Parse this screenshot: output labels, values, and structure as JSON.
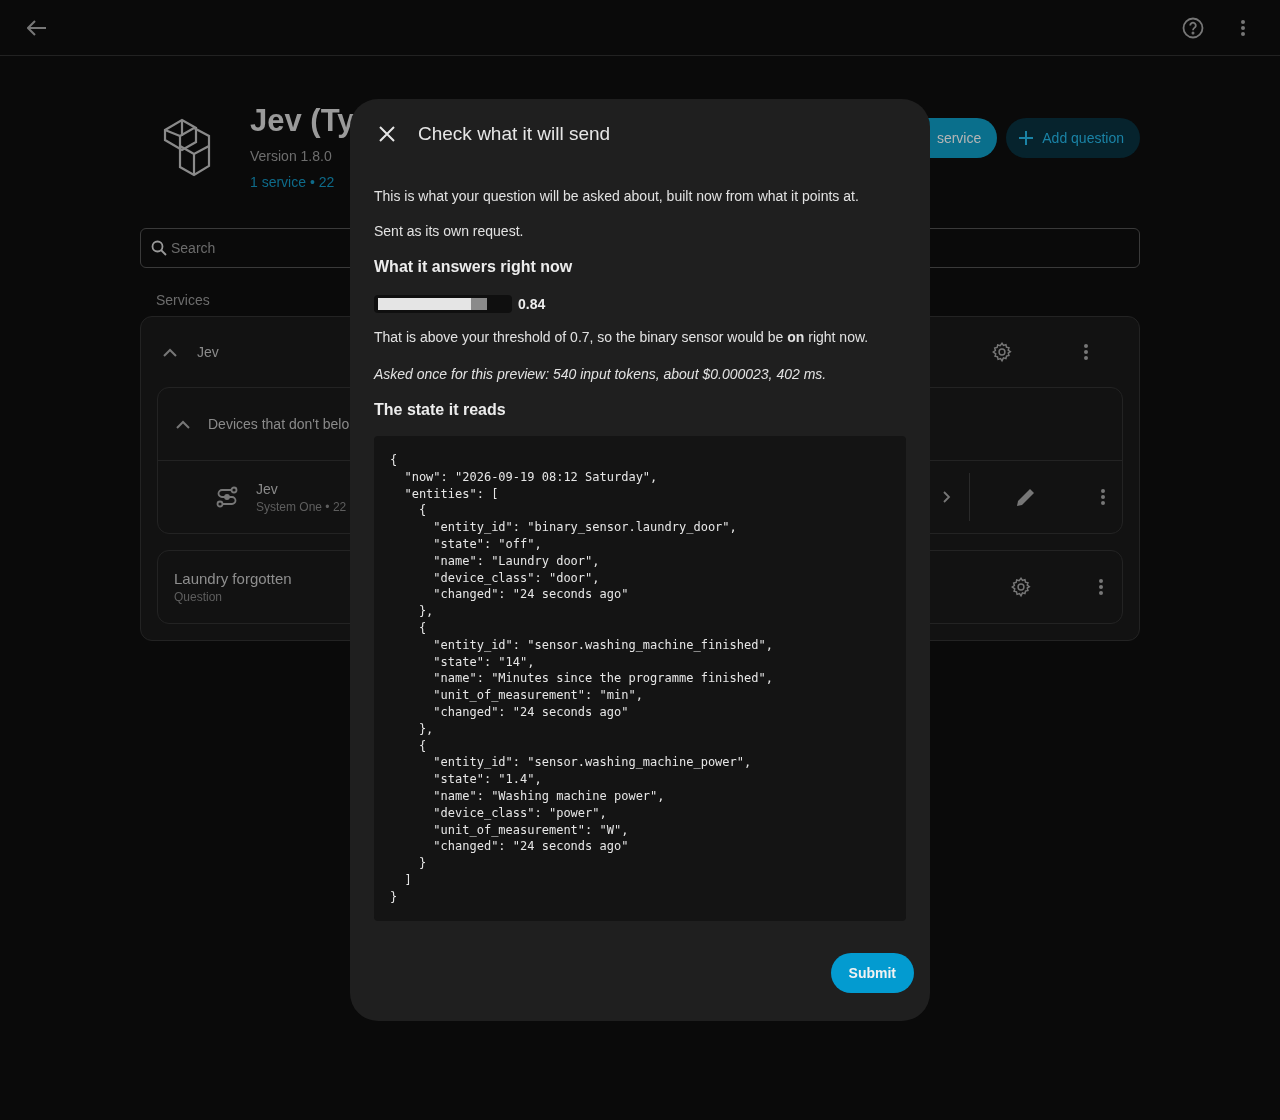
{
  "integration": {
    "title": "Jev (Ty",
    "version": "Version 1.8.0",
    "summary": "1 service • 22",
    "buttons": [
      {
        "label": "service",
        "kind": "filled"
      },
      {
        "label": "Add question",
        "kind": "tonal"
      }
    ]
  },
  "search": {
    "placeholder": "Search"
  },
  "services_heading": "Services",
  "service": {
    "name": "Jev",
    "expanded": true,
    "group": {
      "name": "Devices that don't belo",
      "expanded": true,
      "device": {
        "name": "Jev",
        "subtitle": "System One • 22"
      }
    }
  },
  "question": {
    "name": "Laundry forgotten",
    "subtitle": "Question"
  },
  "dialog": {
    "title": "Check what it will send",
    "intro": "This is what your question will be asked about, built now from what it points at.",
    "note": "Sent as its own request.",
    "answer_heading": "What it answers right now",
    "meter": {
      "level": 0.84,
      "reading": "0.84"
    },
    "verdict": "That is above your threshold of 0.7, so the binary sensor would be **on** right now.",
    "cost": "Asked once for this preview: 540 input tokens, about $0.000023, 402 ms.",
    "state_heading": "The state it reads",
    "code": "{\n  \"now\": \"2026-09-19 08:12 Saturday\",\n  \"entities\": [\n    {\n      \"entity_id\": \"binary_sensor.laundry_door\",\n      \"state\": \"off\",\n      \"name\": \"Laundry door\",\n      \"device_class\": \"door\",\n      \"changed\": \"24 seconds ago\"\n    },\n    {\n      \"entity_id\": \"sensor.washing_machine_finished\",\n      \"state\": \"14\",\n      \"name\": \"Minutes since the programme finished\",\n      \"unit_of_measurement\": \"min\",\n      \"changed\": \"24 seconds ago\"\n    },\n    {\n      \"entity_id\": \"sensor.washing_machine_power\",\n      \"state\": \"1.4\",\n      \"name\": \"Washing machine power\",\n      \"device_class\": \"power\",\n      \"unit_of_measurement\": \"W\",\n      \"changed\": \"24 seconds ago\"\n    }\n  ]\n}",
    "submit": "Submit"
  }
}
